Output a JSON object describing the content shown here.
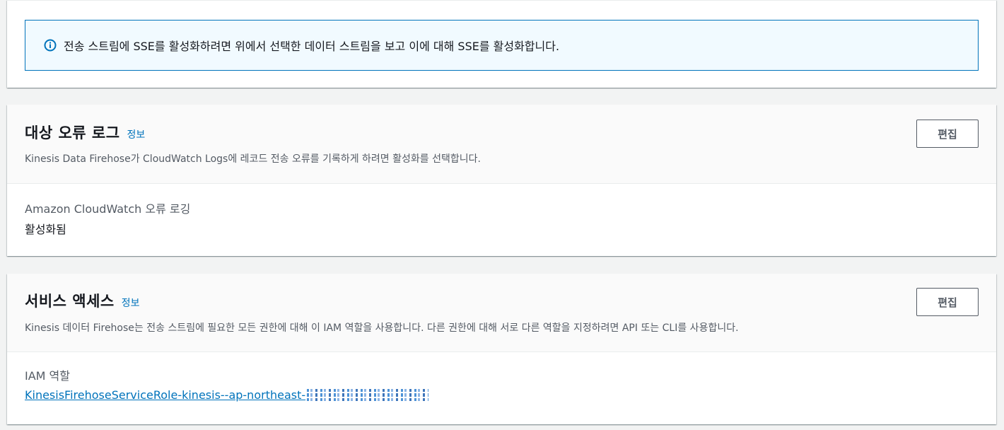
{
  "sse_notice": {
    "icon": "info-circle-icon",
    "text": "전송 스트림에 SSE를 활성화하려면 위에서 선택한 데이터 스트림을 보고 이에 대해 SSE를 활성화합니다."
  },
  "destination_error_logs": {
    "title": "대상 오류 로그",
    "info_link": "정보",
    "description": "Kinesis Data Firehose가 CloudWatch Logs에 레코드 전송 오류를 기록하게 하려면 활성화를 선택합니다.",
    "edit_label": "편집",
    "field_label": "Amazon CloudWatch 오류 로깅",
    "field_value": "활성화됨"
  },
  "service_access": {
    "title": "서비스 액세스",
    "info_link": "정보",
    "description": "Kinesis 데이터 Firehose는 전송 스트림에 필요한 모든 권한에 대해 이 IAM 역할을 사용합니다. 다른 권한에 대해 서로 다른 역할을 지정하려면 API 또는 CLI를 사용합니다.",
    "edit_label": "편집",
    "field_label": "IAM 역할",
    "role_name": "KinesisFirehoseServiceRole-kinesis--ap-northeast-"
  },
  "colors": {
    "link": "#0073bb",
    "info_border": "#0073bb",
    "info_background": "#f1faff",
    "page_background": "#f2f3f3",
    "header_background": "#fafafa",
    "secondary_text": "#545b64"
  }
}
